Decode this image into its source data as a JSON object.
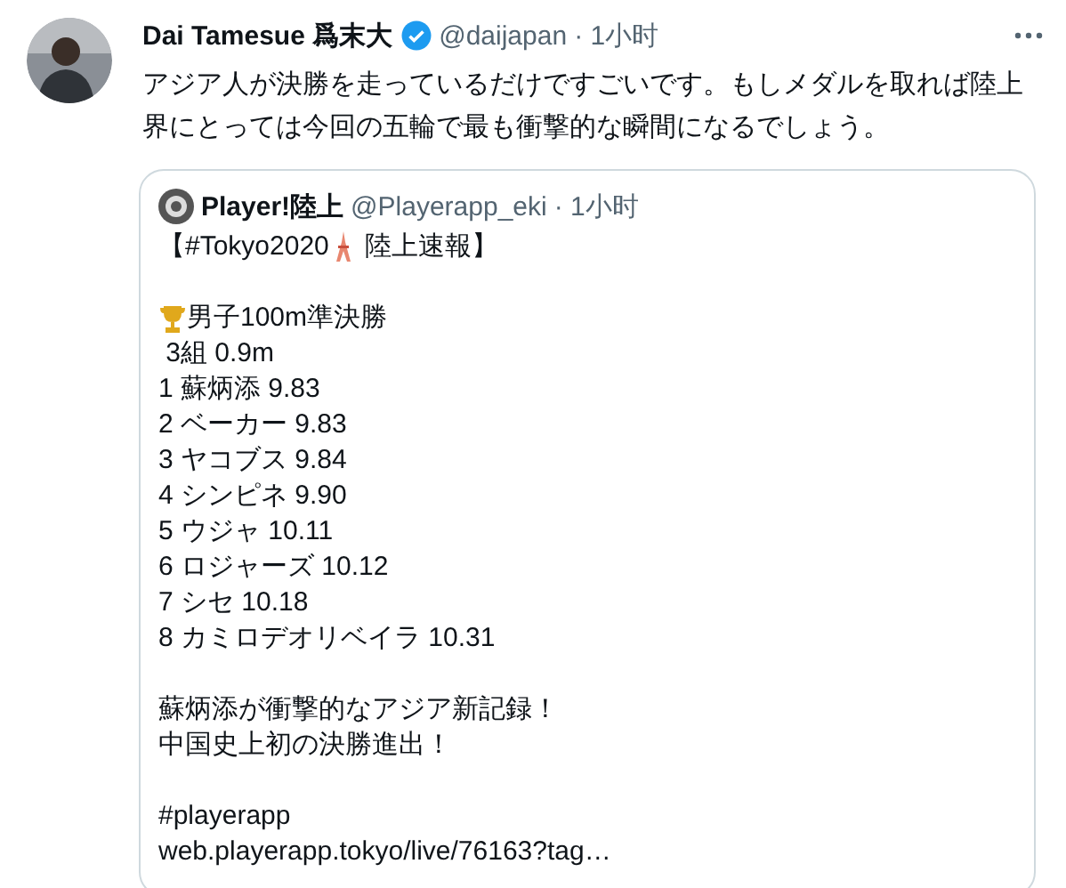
{
  "tweet": {
    "author": "Dai Tamesue 爲末大",
    "verified": true,
    "handle": "@daijapan",
    "time": "· 1小时",
    "text": "アジア人が決勝を走っているだけですごいです。もしメダルを取れば陸上界にとっては今回の五輪で最も衝撃的な瞬間になるでしょう。",
    "quote": {
      "author": "Player!陸上",
      "handle": "@Playerapp_eki",
      "time": "· 1小时",
      "headline": {
        "before": "【#Tokyo2020",
        "after": " 陸上速報】"
      },
      "event": "男子100m準決勝",
      "heat": " 3組 0.9m",
      "results": [
        "1 蘇炳添 9.83",
        "2 ベーカー 9.83",
        "3 ヤコブス 9.84",
        "4 シンピネ 9.90",
        "5 ウジャ 10.11",
        "6 ロジャーズ 10.12",
        "7 シセ 10.18",
        "8 カミロデオリベイラ 10.31"
      ],
      "notes": [
        "蘇炳添が衝撃的なアジア新記録！",
        "中国史上初の決勝進出！"
      ],
      "hashtag": "#playerapp",
      "link": "web.playerapp.tokyo/live/76163?tag…"
    }
  }
}
